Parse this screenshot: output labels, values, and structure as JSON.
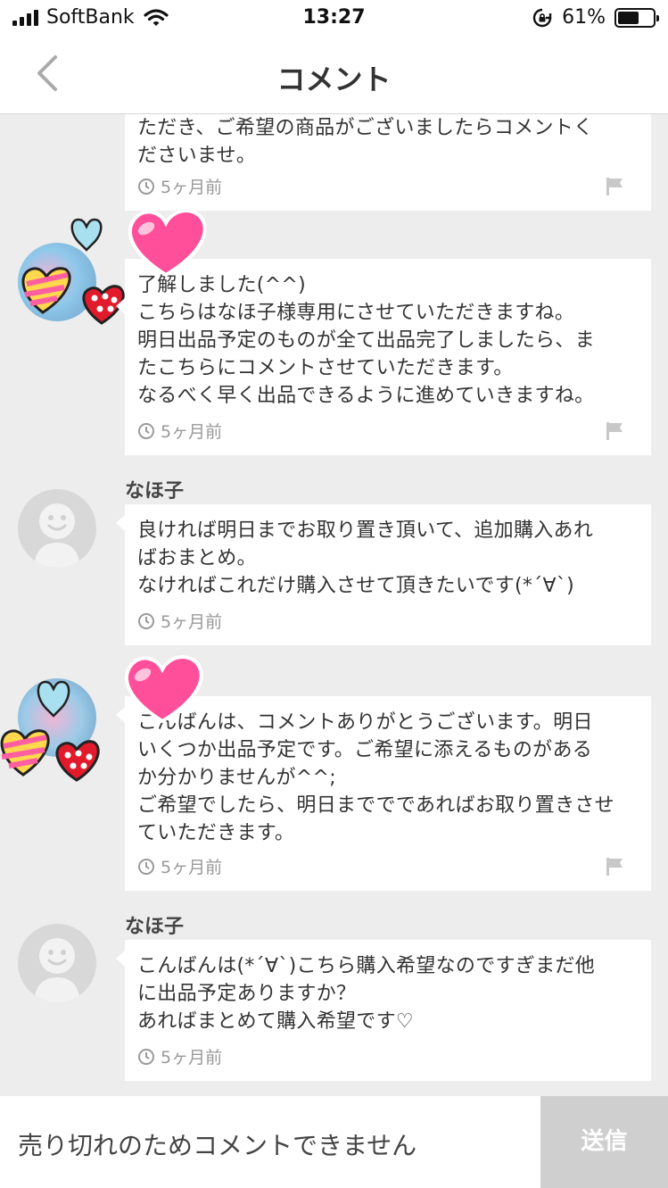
{
  "status_bar": {
    "carrier": "SoftBank",
    "time": "13:27",
    "battery": "61%",
    "battery_level": 0.61,
    "icons": [
      "signal-icon",
      "wifi-icon",
      "rotation-lock-icon",
      "battery-icon"
    ]
  },
  "nav": {
    "title": "コメント",
    "back_icon": "chevron-left-icon"
  },
  "comments": [
    {
      "author": "",
      "text": "ただき、ご希望の商品がございましたらコメントく\nださいませ。",
      "time": "5ヶ月前"
    },
    {
      "author": "",
      "text": "了解しました(^^)\nこちらはなほ子様専用にさせていただきますね。\n明日出品予定のものが全て出品完了しましたら、ま\nたこちらにコメントさせていただきます。\nなるべく早く出品できるように進めていきますね。",
      "time": "5ヶ月前"
    },
    {
      "author": "なほ子",
      "text": "良ければ明日までお取り置き頂いて、追加購入あれ\nばおまとめ。\nなければこれだけ購入させて頂きたいです(*´∀`)",
      "time": "5ヶ月前"
    },
    {
      "author": "",
      "text": "こんばんは、コメントありがとうございます。明日\nいくつか出品予定です。ご希望に添えるものがある\nか分かりませんが^^;\nご希望でしたら、明日まででであればお取り置きさせ\nていただきます。",
      "time": "5ヶ月前"
    },
    {
      "author": "なほ子",
      "text": "こんばんは(*´∀`)こちら購入希望なのですぎまだ他\nに出品予定ありますか？\nあればまとめて購入希望です♡",
      "time": "5ヶ月前"
    }
  ],
  "input": {
    "placeholder": "売り切れのためコメントできません",
    "send_label": "送信"
  },
  "colors": {
    "background": "#ededed",
    "card": "#ffffff",
    "meta_text": "#999999",
    "send_disabled": "#cfcfcf",
    "heart_pink": "#ff4f9a"
  }
}
